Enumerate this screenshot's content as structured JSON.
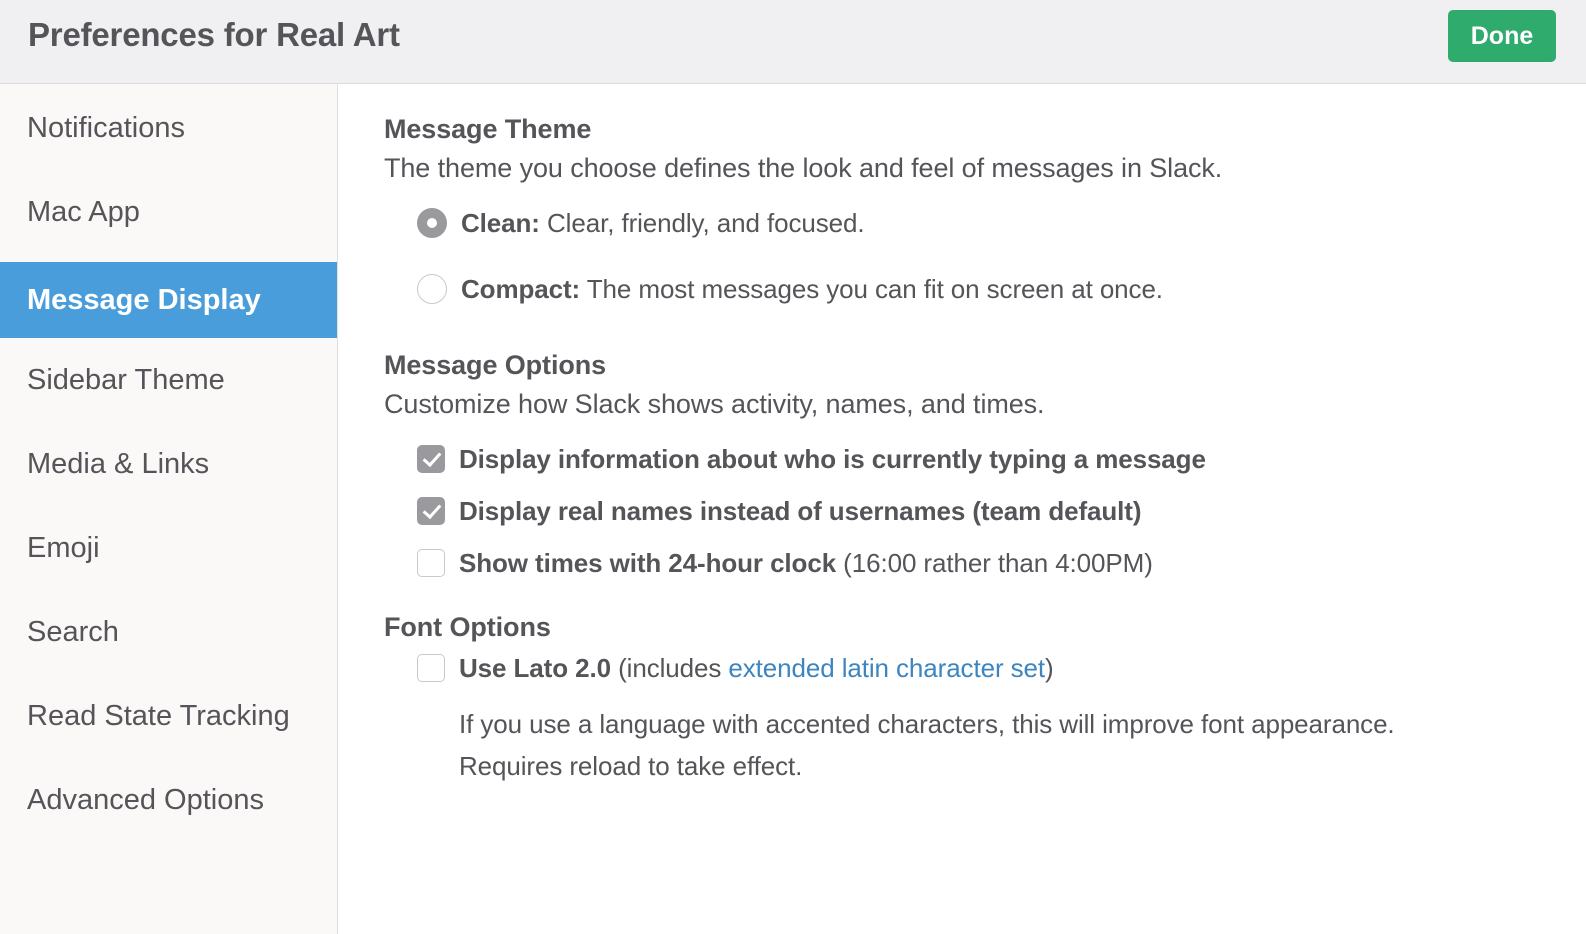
{
  "header": {
    "title": "Preferences for Real Art",
    "done_label": "Done",
    "done_color": "#2fab6e",
    "background": "#f0f0f2"
  },
  "sidebar": {
    "active_index": 2,
    "active_color": "#4a9ddb",
    "background": "#faf9f7",
    "items": [
      {
        "label": "Notifications"
      },
      {
        "label": "Mac App"
      },
      {
        "label": "Message Display"
      },
      {
        "label": "Sidebar Theme"
      },
      {
        "label": "Media & Links"
      },
      {
        "label": "Emoji"
      },
      {
        "label": "Search"
      },
      {
        "label": "Read State Tracking"
      },
      {
        "label": "Advanced Options"
      }
    ]
  },
  "main": {
    "message_theme": {
      "title": "Message Theme",
      "description": "The theme you choose defines the look and feel of messages in Slack.",
      "options": [
        {
          "name": "Clean:",
          "text": " Clear, friendly, and focused.",
          "selected": true
        },
        {
          "name": "Compact:",
          "text": " The most messages you can fit on screen at once.",
          "selected": false
        }
      ]
    },
    "message_options": {
      "title": "Message Options",
      "description": "Customize how Slack shows activity, names, and times.",
      "options": [
        {
          "bold": "Display information about who is currently typing a message",
          "rest": "",
          "checked": true
        },
        {
          "bold": "Display real names instead of usernames (team default)",
          "rest": "",
          "checked": true
        },
        {
          "bold": "Show times with 24-hour clock",
          "rest": " (16:00 rather than 4:00PM)",
          "checked": false
        }
      ]
    },
    "font_options": {
      "title": "Font Options",
      "checkbox_checked": false,
      "label_bold": "Use Lato 2.0",
      "label_pre_link": " (includes ",
      "link_text": "extended latin character set",
      "link_color": "#3d85c0",
      "label_post_link": ")",
      "note_line_1": "If you use a language with accented characters, this will improve font appearance.",
      "note_line_2": "Requires reload to take effect."
    }
  }
}
